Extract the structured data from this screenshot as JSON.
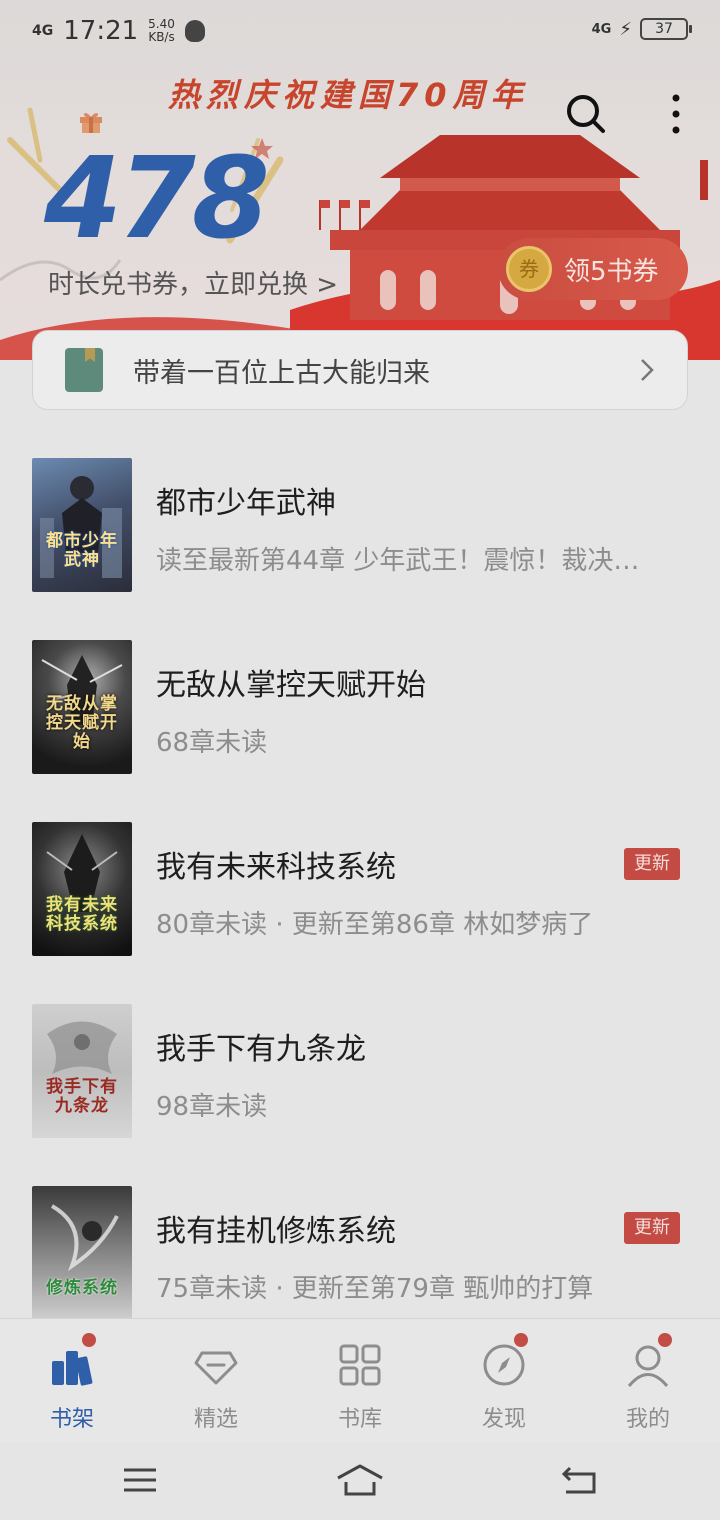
{
  "status_bar": {
    "network": "4G",
    "time": "17:21",
    "speed_value": "5.40",
    "speed_unit": "KB/s",
    "network_right": "4G",
    "battery": "37"
  },
  "header": {
    "slogan": "热烈庆祝建国70周年",
    "reading_minutes": "478",
    "redeem_hint": "时长兑书券，立即兑换 >",
    "coupon_badge": "券",
    "coupon_label": "领5书券"
  },
  "recommendation": {
    "text": "带着一百位上古大能归来"
  },
  "books": [
    {
      "title": "都市少年武神",
      "subtitle": "读至最新第44章 少年武王！震惊！裁决…",
      "cover_text": "都市少年武神",
      "badge": ""
    },
    {
      "title": "无敌从掌控天赋开始",
      "subtitle": "68章未读",
      "cover_text": "无敌从掌控天赋开始",
      "badge": ""
    },
    {
      "title": "我有未来科技系统",
      "subtitle": "80章未读 · 更新至第86章 林如梦病了",
      "cover_text": "我有未来科技系统",
      "badge": "更新"
    },
    {
      "title": "我手下有九条龙",
      "subtitle": "98章未读",
      "cover_text": "我手下有九条龙",
      "badge": ""
    },
    {
      "title": "我有挂机修炼系统",
      "subtitle": "75章未读 · 更新至第79章 甄帅的打算",
      "cover_text": "修炼系统",
      "badge": "更新"
    }
  ],
  "tabs": [
    {
      "label": "书架",
      "icon": "bookshelf-icon",
      "active": true,
      "dot": true
    },
    {
      "label": "精选",
      "icon": "diamond-icon",
      "active": false,
      "dot": false
    },
    {
      "label": "书库",
      "icon": "grid-icon",
      "active": false,
      "dot": false
    },
    {
      "label": "发现",
      "icon": "compass-icon",
      "active": false,
      "dot": true
    },
    {
      "label": "我的",
      "icon": "user-icon",
      "active": false,
      "dot": true
    }
  ],
  "colors": {
    "accent": "#2f5fa8",
    "badge_red": "#c34b44",
    "dot_red": "#c24d46"
  }
}
